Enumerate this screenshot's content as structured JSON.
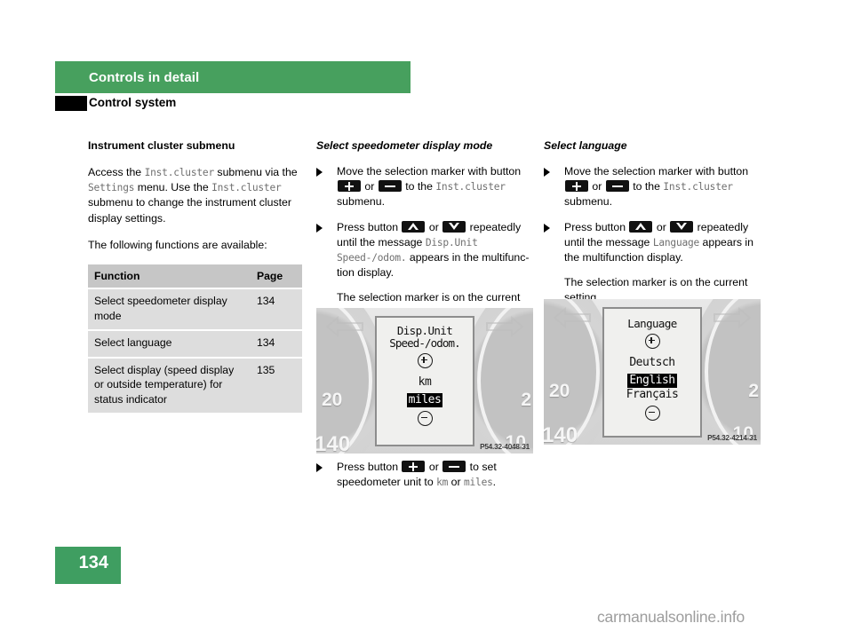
{
  "header": {
    "chapter": "Controls in detail",
    "section": "Control system"
  },
  "left_column": {
    "heading": "Instrument cluster submenu",
    "paragraph1_a": "Access the ",
    "paragraph1_mono1": "Inst.cluster",
    "paragraph1_b": " submenu via the ",
    "paragraph1_mono2": "Settings",
    "paragraph1_c": " menu. Use the ",
    "paragraph1_mono3": "Inst.cluster",
    "paragraph1_d": " submenu to change the instrument cluster display settings.",
    "paragraph2": "The following functions are available:",
    "table": {
      "headers": [
        "Function",
        "Page"
      ],
      "rows": [
        {
          "function": "Select speedometer display mode",
          "page": "134"
        },
        {
          "function": "Select language",
          "page": "134"
        },
        {
          "function": "Select display (speed display or outside temperature) for status indicator",
          "page": "135"
        }
      ]
    }
  },
  "middle_column": {
    "heading": "Select speedometer display mode",
    "step1_a": "Move the selection marker with button ",
    "step1_btn1": "plus-button-icon",
    "step1_or": " or ",
    "step1_btn2": "minus-button-icon",
    "step1_b": " to the ",
    "step1_mono": "Inst.cluster",
    "step1_c": " submenu.",
    "step2_a": "Press button ",
    "step2_btn1": "up-button-icon",
    "step2_or": " or ",
    "step2_btn2": "down-button-icon",
    "step2_b": " repeatedly until the message ",
    "step2_mono1": "Disp.Unit",
    "step2_mono2": "Speed-/odom.",
    "step2_c": " appears in the multifunc-tion display.",
    "note": "The selection marker is on the current setting.",
    "step3_a": "Press button ",
    "step3_or": " or ",
    "step3_b": " to set speedometer unit to ",
    "step3_mono1": "km",
    "step3_mid": " or ",
    "step3_mono2": "miles",
    "step3_c": ".",
    "figure": {
      "code": "P54.32-4048-31",
      "lcd_title": "Disp.Unit",
      "lcd_subtitle": "Speed-/odom.",
      "options": [
        "km",
        "miles"
      ],
      "selected": "miles",
      "gauge_labels": [
        "20",
        "140",
        "10",
        "2"
      ]
    }
  },
  "right_column": {
    "heading": "Select language",
    "step1_a": "Move the selection marker with button ",
    "step1_or": " or ",
    "step1_b": " to the ",
    "step1_mono": "Inst.cluster",
    "step1_c": " submenu.",
    "step2_a": "Press button ",
    "step2_or": " or ",
    "step2_b": " repeatedly until the message ",
    "step2_mono": "Language",
    "step2_c": " appears in the multifunction display.",
    "note": "The selection marker is on the current setting.",
    "figure": {
      "code": "P54.32-4214-31",
      "lcd_title": "Language",
      "options": [
        "Deutsch",
        "English",
        "Français"
      ],
      "selected": "English",
      "gauge_labels": [
        "20",
        "140",
        "10",
        "2"
      ]
    }
  },
  "footer": {
    "page_number": "134",
    "watermark": "carmanualsonline.info"
  },
  "colors": {
    "brand_green": "#47a05e",
    "footer_green": "#3f9e61",
    "table_header": "#c6c6c6",
    "table_row": "#dddddd",
    "mono_gray": "#6f6f6f"
  }
}
